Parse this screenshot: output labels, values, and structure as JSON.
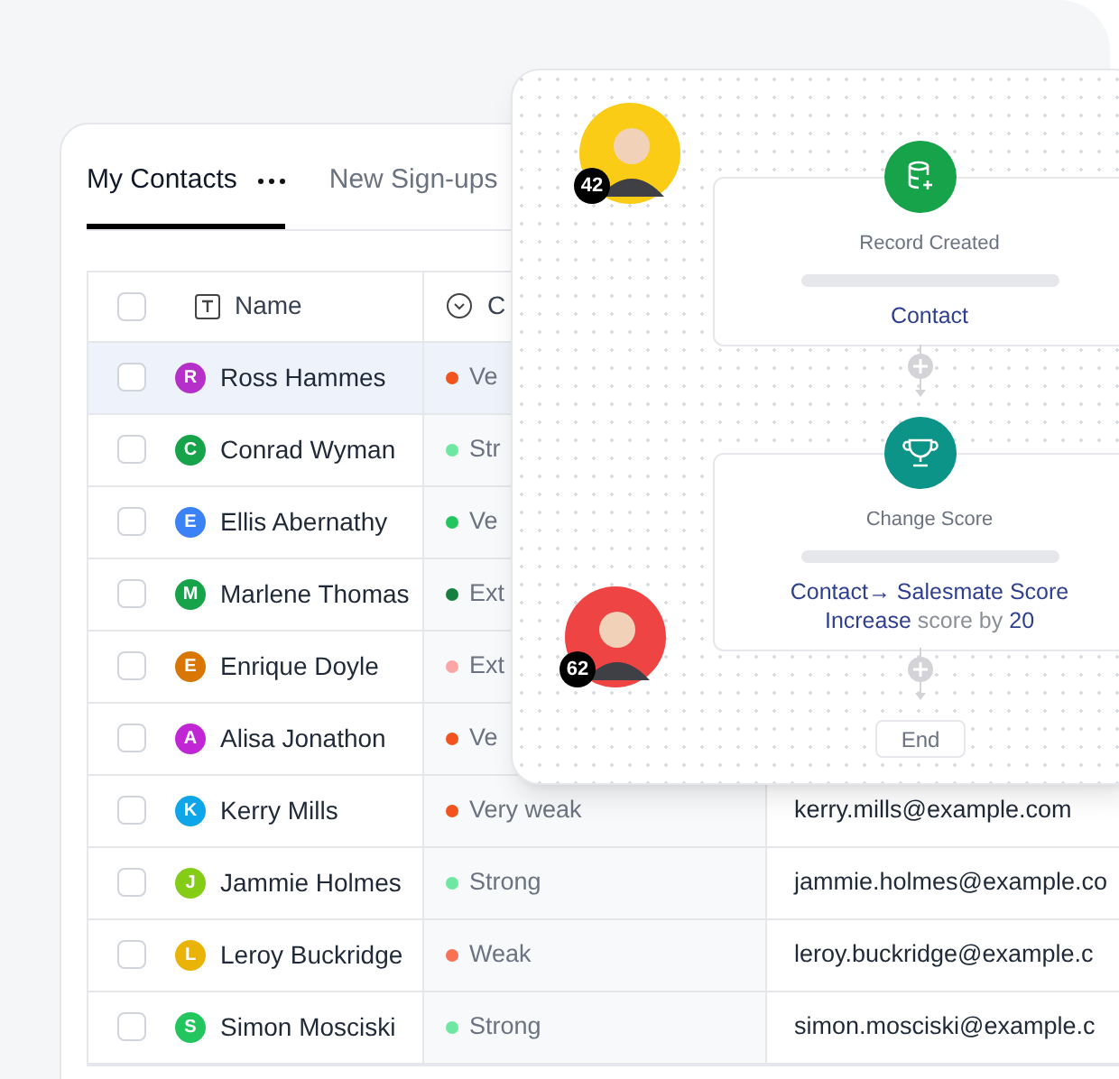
{
  "tabs": [
    {
      "label": "My Contacts",
      "selected": true
    },
    {
      "label": "New Sign-ups",
      "selected": false
    }
  ],
  "table": {
    "header_checked": false,
    "columns": [
      {
        "kind": "name",
        "label": "Name"
      },
      {
        "kind": "status",
        "label": "C"
      }
    ],
    "rows": [
      {
        "checked": false,
        "selected": true,
        "avatar": {
          "initial": "R",
          "color": "#b52fc9"
        },
        "name": "Ross Hammes",
        "status": "Ve",
        "color": "#f1541d",
        "email": null
      },
      {
        "checked": false,
        "selected": false,
        "avatar": {
          "initial": "C",
          "color": "#16a34a"
        },
        "name": "Conrad Wyman",
        "status": "Str",
        "color": "#6ee7a0",
        "email": null
      },
      {
        "checked": false,
        "selected": false,
        "avatar": {
          "initial": "E",
          "color": "#3b82f6"
        },
        "name": "Ellis Abernathy",
        "status": "Ve",
        "color": "#22c55e",
        "email": null
      },
      {
        "checked": false,
        "selected": false,
        "avatar": {
          "initial": "M",
          "color": "#16a34a"
        },
        "name": "Marlene Thomas",
        "status": "Ext",
        "color": "#15803d",
        "email": null
      },
      {
        "checked": false,
        "selected": false,
        "avatar": {
          "initial": "E",
          "color": "#d97706"
        },
        "name": "Enrique Doyle",
        "status": "Ext",
        "color": "#fca5a5",
        "email": null
      },
      {
        "checked": false,
        "selected": false,
        "avatar": {
          "initial": "A",
          "color": "#c026d3"
        },
        "name": "Alisa Jonathon",
        "status": "Ve",
        "color": "#f1541d",
        "email": null
      },
      {
        "checked": false,
        "selected": false,
        "avatar": {
          "initial": "K",
          "color": "#0ea5e9"
        },
        "name": "Kerry Mills",
        "status": "Very weak",
        "color": "#f1541d",
        "email": "kerry.mills@example.com"
      },
      {
        "checked": false,
        "selected": false,
        "avatar": {
          "initial": "J",
          "color": "#84cc16"
        },
        "name": "Jammie Holmes",
        "status": "Strong",
        "color": "#6ee7a0",
        "email": "jammie.holmes@example.co"
      },
      {
        "checked": false,
        "selected": false,
        "avatar": {
          "initial": "L",
          "color": "#eab308"
        },
        "name": "Leroy Buckridge",
        "status": "Weak",
        "color": "#f87155",
        "email": "leroy.buckridge@example.c"
      },
      {
        "checked": false,
        "selected": false,
        "avatar": {
          "initial": "S",
          "color": "#22c55e"
        },
        "name": "Simon Mosciski",
        "status": "Strong",
        "color": "#6ee7a0",
        "email": "simon.mosciski@example.c"
      }
    ]
  },
  "workflow": {
    "people": [
      {
        "score": "42",
        "color": "#facc15"
      },
      {
        "score": "62",
        "color": "#ef4444"
      }
    ],
    "steps": [
      {
        "kind": "trigger",
        "title": "Record Created",
        "lines": [
          [
            {
              "text": "Contact",
              "kind": "value"
            }
          ]
        ]
      },
      {
        "kind": "action",
        "title": "Change Score",
        "lines": [
          [
            {
              "text": "Contact→ Salesmate Score",
              "kind": "value"
            }
          ],
          [
            {
              "text": "Increase",
              "kind": "value"
            },
            {
              "text": "score by",
              "kind": "plain"
            },
            {
              "text": "20",
              "kind": "value"
            }
          ]
        ]
      }
    ],
    "end_label": "End"
  }
}
